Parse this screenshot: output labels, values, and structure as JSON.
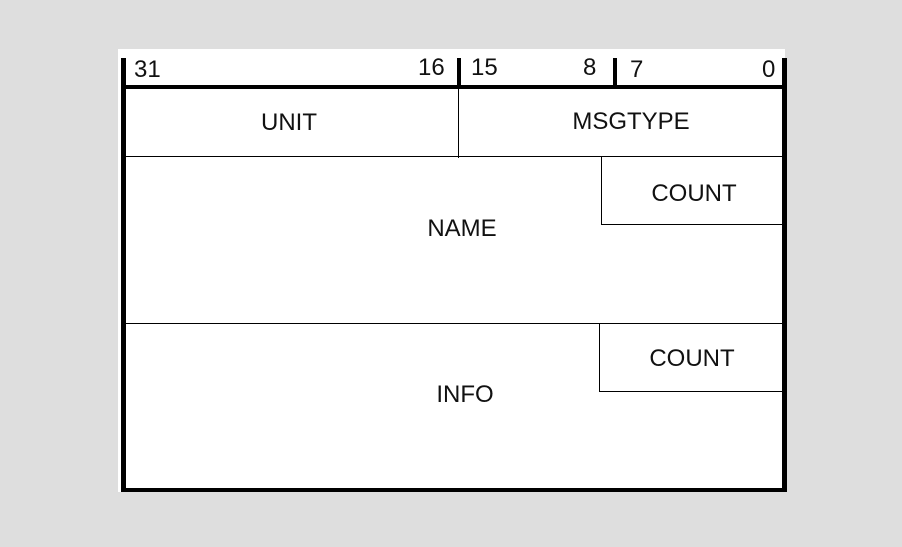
{
  "diagram": {
    "title": "",
    "bit_header": {
      "groups": [
        {
          "high": "31",
          "low": "16"
        },
        {
          "high": "15",
          "low": "8"
        },
        {
          "high": "7",
          "low": "0"
        }
      ]
    },
    "rows": [
      {
        "fields": [
          {
            "name": "UNIT",
            "bits": "31-16"
          },
          {
            "name": "MSGTYPE",
            "bits": "15-0"
          }
        ]
      },
      {
        "fields": [
          {
            "name": "NAME"
          },
          {
            "name": "COUNT"
          }
        ]
      },
      {
        "fields": [
          {
            "name": "INFO"
          },
          {
            "name": "COUNT"
          }
        ]
      }
    ]
  }
}
